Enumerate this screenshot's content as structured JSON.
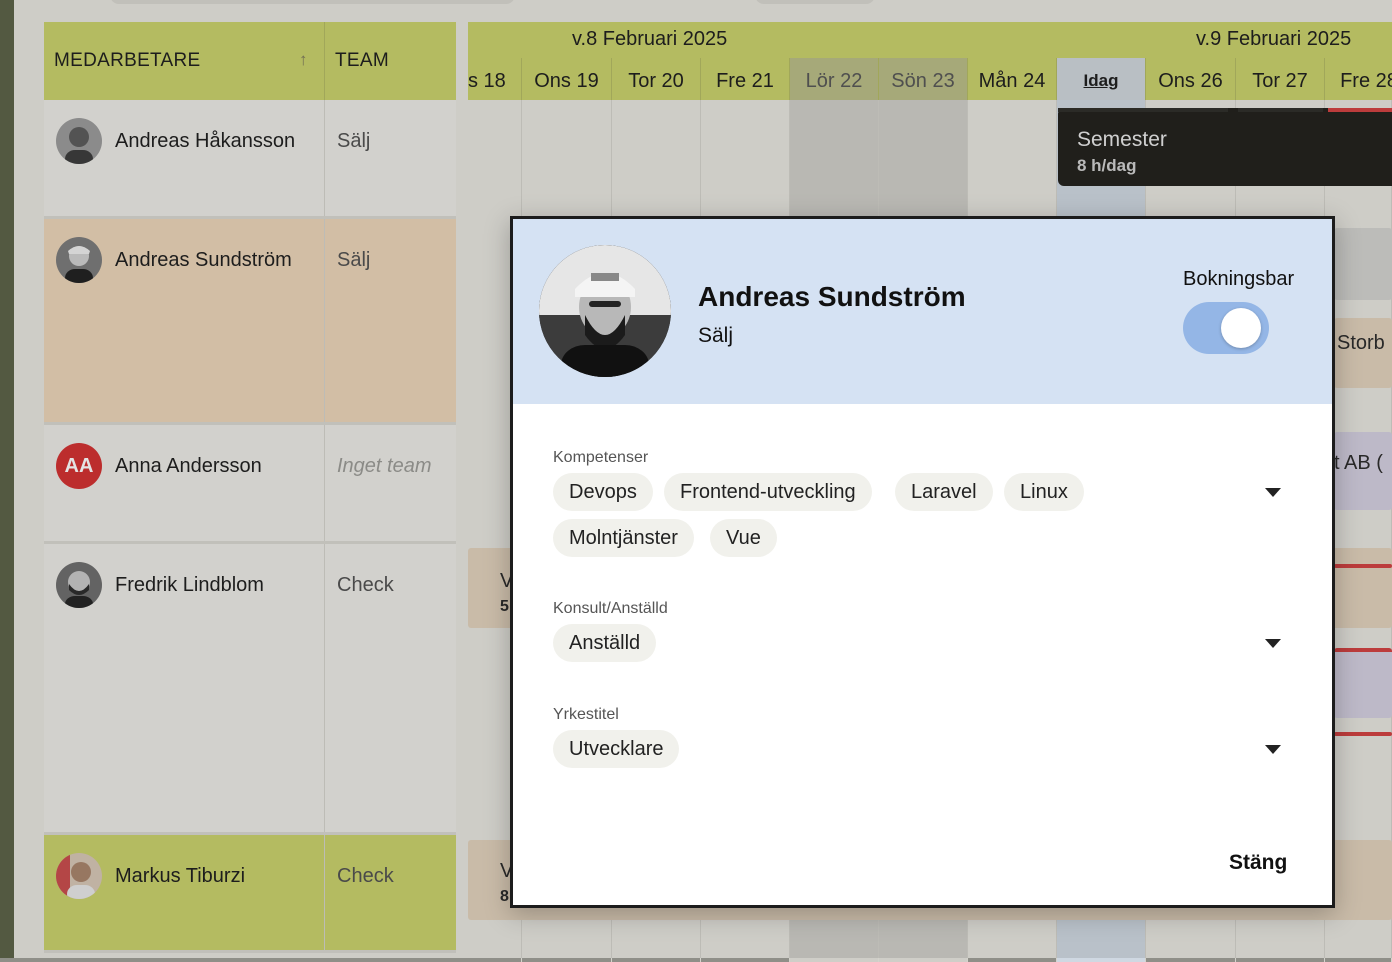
{
  "table": {
    "header_name": "MEDARBETARE",
    "header_sort": "↑",
    "header_team": "TEAM"
  },
  "employees": [
    {
      "name": "Andreas Håkansson",
      "team": "Sälj"
    },
    {
      "name": "Andreas Sundström",
      "team": "Sälj"
    },
    {
      "name": "Anna Andersson",
      "team": "Inget team",
      "initials": "AA"
    },
    {
      "name": "Fredrik Lindblom",
      "team": "Check"
    },
    {
      "name": "Markus Tiburzi",
      "team": "Check"
    }
  ],
  "calendar": {
    "weeks": [
      "v.8 Februari 2025",
      "v.9 Februari 2025"
    ],
    "days": [
      "s 18",
      "Ons 19",
      "Tor 20",
      "Fre 21",
      "Lör 22",
      "Sön 23",
      "Mån 24",
      "Idag",
      "Ons 26",
      "Tor 27",
      "Fre 28"
    ],
    "booking": {
      "title": "Semester",
      "subtitle": "8 h/dag"
    },
    "partial_texts": [
      "Storb",
      "t AB (",
      "V",
      "5",
      "V",
      "8"
    ]
  },
  "modal": {
    "name": "Andreas Sundström",
    "team": "Sälj",
    "bookable_label": "Bokningsbar",
    "bookable": true,
    "competences_label": "Kompetenser",
    "competences": [
      "Devops",
      "Frontend-utveckling",
      "Laravel",
      "Linux",
      "Molntjänster",
      "Vue"
    ],
    "employment_label": "Konsult/Anställd",
    "employment": "Anställd",
    "title_label": "Yrkestitel",
    "title": "Utvecklare",
    "close_label": "Stäng"
  },
  "colors": {
    "header": "#c9d16a",
    "highlight_row": "#ecd5b8",
    "modal_header": "#d5e2f3",
    "toggle": "#94b6e6",
    "booking_dark": "#1f1e1a",
    "avatar_red": "#d32f2f"
  }
}
